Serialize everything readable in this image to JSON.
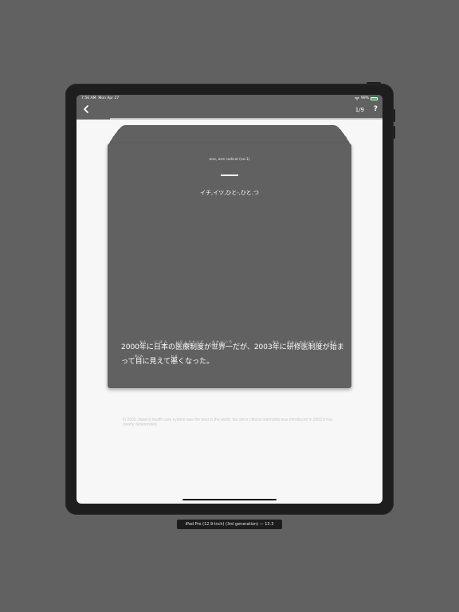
{
  "status": {
    "time": "7:56 AM",
    "date": "Mon Apr 27",
    "battery": "99%"
  },
  "nav": {
    "counter": "1/9",
    "help": "?",
    "progress": 0.11
  },
  "card": {
    "meaning": "one, one radical (no.1)",
    "readings": "イチ,イツ,ひと-,ひと.つ",
    "sentence": [
      {
        "text": "2000",
        "ruby": ""
      },
      {
        "text": "年",
        "ruby": "ねん"
      },
      {
        "text": "に",
        "ruby": ""
      },
      {
        "text": "日本",
        "ruby": "にほん"
      },
      {
        "text": "の",
        "ruby": ""
      },
      {
        "text": "医療制度",
        "ruby": "いりょうせいど"
      },
      {
        "text": "が",
        "ruby": ""
      },
      {
        "text": "世界一",
        "ruby": "せかいいち"
      },
      {
        "text": "だが、2003",
        "ruby": ""
      },
      {
        "text": "年",
        "ruby": "ねん"
      },
      {
        "text": "に",
        "ruby": ""
      },
      {
        "text": "研修医制度",
        "ruby": "けんしゅういせいど"
      },
      {
        "text": "が",
        "ruby": ""
      },
      {
        "text": "始",
        "ruby": "はじ"
      },
      {
        "text": "まって",
        "ruby": ""
      },
      {
        "text": "目",
        "ruby": "めにみ"
      },
      {
        "text": "に見えて",
        "ruby": ""
      },
      {
        "text": "悪",
        "ruby": "わる"
      },
      {
        "text": "くなった。",
        "ruby": ""
      }
    ],
    "translation": "In 2000 Japan's health care system was the best in the world, but since clinical internship was introduced in 2003 it has clearly deteriorated."
  },
  "device_label": "iPad Pro (12.9-inch) (3rd generation) — 13.3",
  "colors": {
    "bar": "#616161",
    "card": "#616161",
    "screen": "#f7f7f7",
    "battery": "#4cd964"
  }
}
